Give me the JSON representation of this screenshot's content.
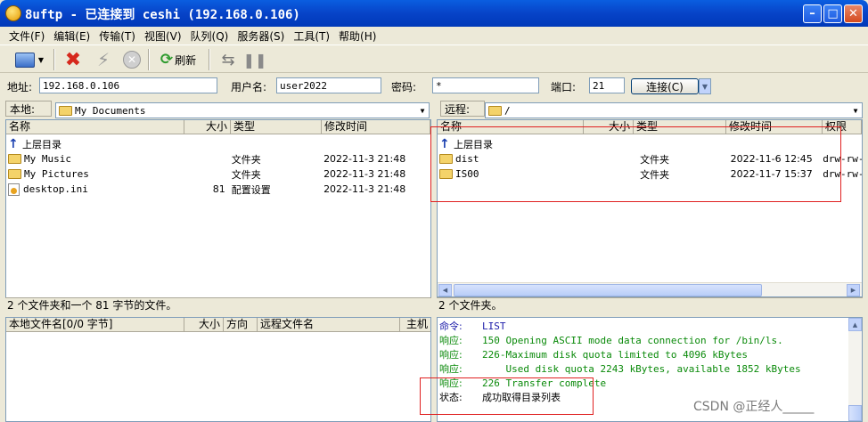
{
  "window": {
    "title": "8uftp - 已连接到 ceshi (192.168.0.106)"
  },
  "menu": [
    "文件(F)",
    "编辑(E)",
    "传输(T)",
    "视图(V)",
    "队列(Q)",
    "服务器(S)",
    "工具(T)",
    "帮助(H)"
  ],
  "toolbar": {
    "refresh_label": "刷新"
  },
  "connection": {
    "address_label": "地址:",
    "address_value": "192.168.0.106",
    "user_label": "用户名:",
    "user_value": "user2022",
    "password_label": "密码:",
    "password_value": "*",
    "port_label": "端口:",
    "port_value": "21",
    "connect_label": "连接(C)"
  },
  "local": {
    "pane_label": "本地:",
    "path": "My Documents",
    "columns": [
      "名称",
      "大小",
      "类型",
      "修改时间"
    ],
    "parent_label": "上层目录",
    "files": [
      {
        "name": "My Music",
        "size": "",
        "type": "文件夹",
        "modified": "2022-11-3 21:48",
        "icon": "music-folder-icon"
      },
      {
        "name": "My Pictures",
        "size": "",
        "type": "文件夹",
        "modified": "2022-11-3 21:48",
        "icon": "pictures-folder-icon"
      },
      {
        "name": "desktop.ini",
        "size": "81",
        "type": "配置设置",
        "modified": "2022-11-3 21:48",
        "icon": "settings-file-icon"
      }
    ],
    "status": "2 个文件夹和一个 81 字节的文件。"
  },
  "remote": {
    "pane_label": "远程:",
    "path": "/",
    "columns": [
      "名称",
      "大小",
      "类型",
      "修改时间",
      "权限"
    ],
    "parent_label": "上层目录",
    "files": [
      {
        "name": "dist",
        "size": "",
        "type": "文件夹",
        "modified": "2022-11-6 12:45",
        "perm": "drw-rw-"
      },
      {
        "name": "IS00",
        "size": "",
        "type": "文件夹",
        "modified": "2022-11-7 15:37",
        "perm": "drw-rw-"
      }
    ],
    "status": "2 个文件夹。"
  },
  "queue": {
    "columns": [
      "本地文件名[0/0 字节]",
      "大小",
      "方向",
      "远程文件名",
      "主机"
    ]
  },
  "log": [
    {
      "key": "命令:",
      "text": "LIST"
    },
    {
      "key": "响应:",
      "text": "150 Opening ASCII mode data connection for /bin/ls."
    },
    {
      "key": "响应:",
      "text": "226-Maximum disk quota limited to 4096 kBytes"
    },
    {
      "key": "响应:",
      "text": "    Used disk quota 2243 kBytes, available 1852 kBytes"
    },
    {
      "key": "响应:",
      "text": "226 Transfer complete"
    },
    {
      "key": "状态:",
      "text": "成功取得目录列表"
    }
  ],
  "watermark": "CSDN @正经人_____",
  "colors": {
    "titlebar": "#0743c8",
    "log_text": "#0a8a0a",
    "highlight_box": "#e02020"
  }
}
